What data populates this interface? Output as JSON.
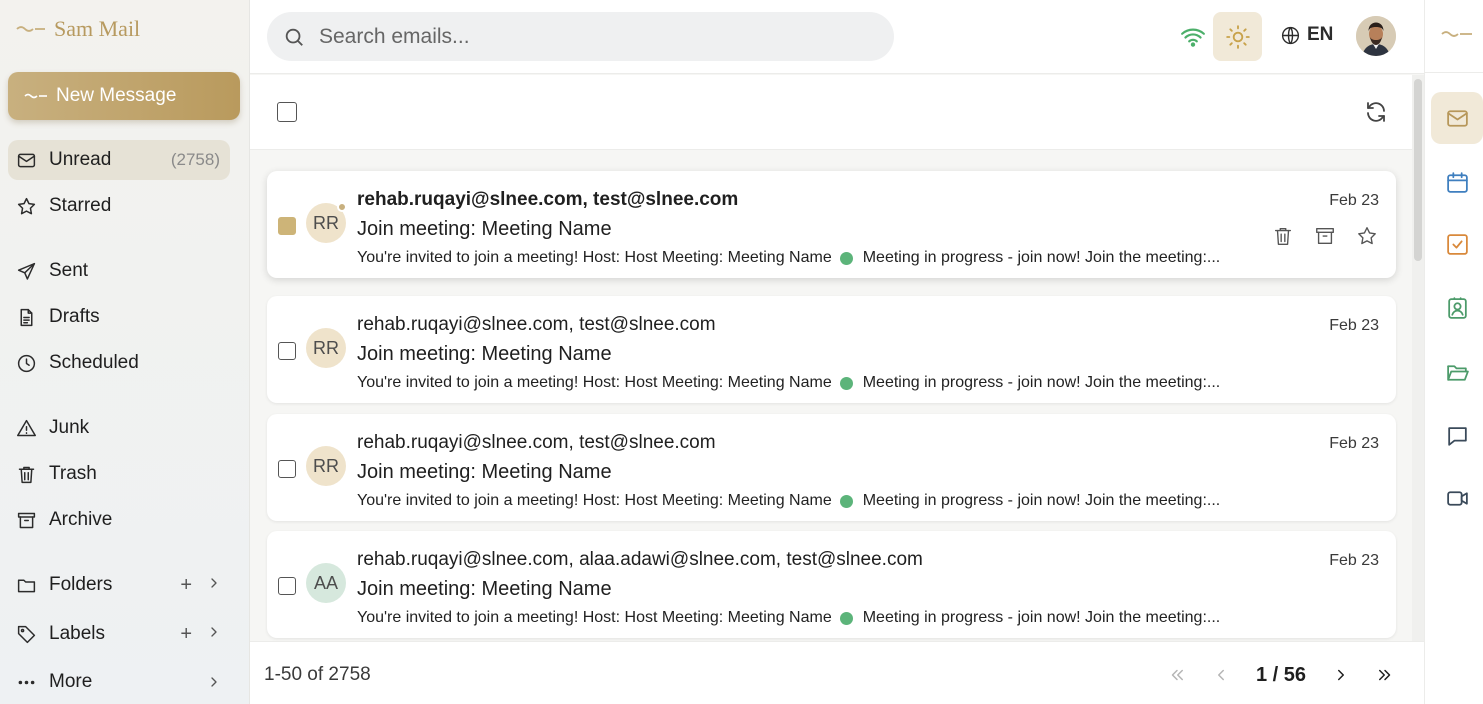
{
  "app": {
    "name": "Sam Mail"
  },
  "sidebar": {
    "new_message": "New Message",
    "items": [
      {
        "label": "Unread",
        "icon": "mail-icon",
        "count": "(2758)"
      },
      {
        "label": "Starred",
        "icon": "star-icon"
      },
      {
        "label": "Sent",
        "icon": "send-icon"
      },
      {
        "label": "Drafts",
        "icon": "file-icon"
      },
      {
        "label": "Scheduled",
        "icon": "clock-icon"
      },
      {
        "label": "Junk",
        "icon": "warning-icon"
      },
      {
        "label": "Trash",
        "icon": "trash-icon"
      },
      {
        "label": "Archive",
        "icon": "archive-icon"
      },
      {
        "label": "Folders",
        "icon": "folder-icon"
      },
      {
        "label": "Labels",
        "icon": "tag-icon"
      },
      {
        "label": "More",
        "icon": "more-icon"
      }
    ]
  },
  "topbar": {
    "search_placeholder": "Search emails...",
    "language": "EN"
  },
  "emails": [
    {
      "initials": "RR",
      "avatar_color": "#efe3cb",
      "from": "rehab.ruqayi@slnee.com, test@slnee.com",
      "subject": "Join meeting: Meeting Name",
      "preview_a": "You're invited to join a meeting! Host: Host Meeting: Meeting Name",
      "preview_b": "Meeting in progress - join now! Join the meeting:...",
      "date": "Feb 23"
    },
    {
      "initials": "RR",
      "avatar_color": "#efe3cb",
      "from": "rehab.ruqayi@slnee.com, test@slnee.com",
      "subject": "Join meeting: Meeting Name",
      "preview_a": "You're invited to join a meeting! Host: Host Meeting: Meeting Name",
      "preview_b": "Meeting in progress - join now! Join the meeting:...",
      "date": "Feb 23"
    },
    {
      "initials": "RR",
      "avatar_color": "#efe3cb",
      "from": "rehab.ruqayi@slnee.com, test@slnee.com",
      "subject": "Join meeting: Meeting Name",
      "preview_a": "You're invited to join a meeting! Host: Host Meeting: Meeting Name",
      "preview_b": "Meeting in progress - join now! Join the meeting:...",
      "date": "Feb 23"
    },
    {
      "initials": "AA",
      "avatar_color": "#d6e8dd",
      "from": "rehab.ruqayi@slnee.com, alaa.adawi@slnee.com, test@slnee.com",
      "subject": "Join meeting: Meeting Name",
      "preview_a": "You're invited to join a meeting! Host: Host Meeting: Meeting Name",
      "preview_b": "Meeting in progress - join now! Join the meeting:...",
      "date": "Feb 23"
    }
  ],
  "footer": {
    "range": "1-50 of 2758",
    "page": "1 / 56"
  },
  "colors": {
    "accent": "#c8b07f",
    "accent_dark": "#b99a5d",
    "status_green": "#5cb47a"
  }
}
